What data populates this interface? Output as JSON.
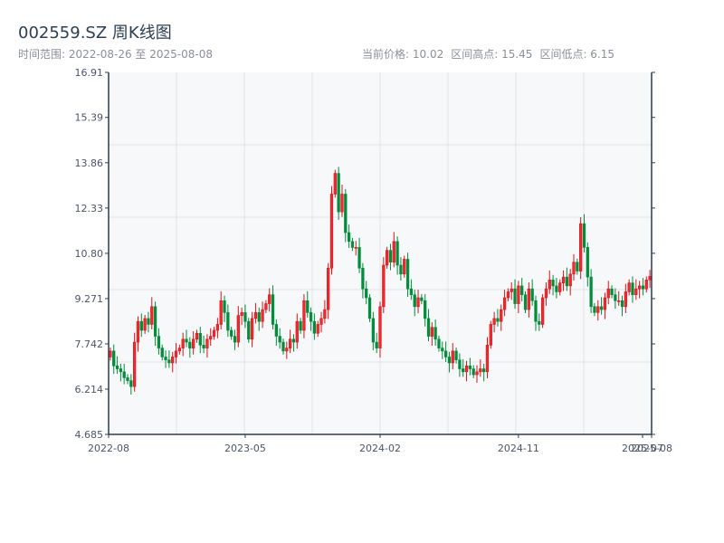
{
  "header": {
    "title": "002559.SZ 周K线图",
    "range_label": "时间范围: 2022-08-26 至 2025-08-08",
    "current_price": "当前价格: 10.02",
    "high": "区间高点: 15.45",
    "low": "区间低点: 6.15"
  },
  "chart_data": {
    "type": "candlestick",
    "title": "002559.SZ 周K线图",
    "ylim": [
      4.685,
      16.91
    ],
    "y_ticks": [
      "16.91",
      "15.39",
      "13.86",
      "12.33",
      "10.80",
      "9.271",
      "7.742",
      "6.214",
      "4.685"
    ],
    "y_tick_values": [
      16.91,
      15.39,
      13.86,
      12.33,
      10.8,
      9.271,
      7.742,
      6.214,
      4.685
    ],
    "x_ticks": [
      {
        "label": "2022-08",
        "index": 0
      },
      {
        "label": "2023-05",
        "index": 39
      },
      {
        "label": "2024-02",
        "index": 78
      },
      {
        "label": "2024-11",
        "index": 118
      },
      {
        "label": "2025-07",
        "index": 154
      },
      {
        "label": "2025-08",
        "index": 156
      }
    ],
    "up_color": "#d7141a",
    "down_color": "#008c3a",
    "open_first": 7.3,
    "close": [
      7.5,
      7.0,
      6.9,
      6.8,
      6.6,
      6.5,
      6.3,
      7.8,
      8.5,
      8.2,
      8.6,
      8.4,
      9.0,
      8.0,
      7.6,
      7.3,
      7.2,
      7.1,
      7.3,
      7.5,
      7.6,
      7.9,
      7.8,
      7.6,
      7.9,
      8.1,
      7.7,
      7.6,
      7.9,
      8.0,
      8.2,
      8.4,
      9.2,
      8.8,
      8.2,
      8.0,
      7.8,
      8.7,
      8.8,
      8.5,
      7.9,
      8.6,
      8.8,
      8.5,
      8.9,
      9.1,
      9.4,
      8.4,
      8.0,
      7.8,
      7.5,
      7.6,
      7.9,
      7.8,
      8.5,
      8.2,
      9.2,
      8.8,
      8.5,
      8.1,
      8.4,
      8.6,
      8.9,
      10.3,
      12.8,
      13.5,
      12.2,
      12.8,
      11.5,
      11.2,
      11.0,
      11.0,
      10.3,
      9.6,
      9.3,
      8.6,
      7.8,
      7.6,
      9.0,
      10.4,
      10.9,
      10.5,
      11.2,
      10.4,
      10.1,
      10.6,
      9.6,
      9.4,
      9.0,
      9.3,
      9.2,
      8.6,
      8.0,
      8.3,
      7.9,
      7.6,
      7.5,
      7.3,
      7.1,
      7.5,
      7.2,
      6.9,
      6.8,
      7.0,
      6.9,
      6.7,
      6.8,
      6.9,
      6.8,
      7.7,
      8.4,
      8.6,
      8.5,
      8.9,
      9.3,
      9.5,
      9.6,
      9.1,
      9.7,
      9.4,
      8.9,
      9.6,
      9.2,
      8.5,
      8.4,
      9.3,
      9.6,
      9.9,
      9.7,
      9.5,
      9.8,
      10.0,
      9.7,
      10.1,
      10.5,
      10.2,
      11.8,
      11.0,
      10.0,
      9.0,
      8.8,
      9.0,
      8.9,
      9.3,
      9.6,
      9.4,
      9.2,
      9.2,
      9.0,
      9.5,
      9.8,
      9.4,
      9.6,
      9.7,
      9.6,
      9.9,
      10.02
    ]
  }
}
